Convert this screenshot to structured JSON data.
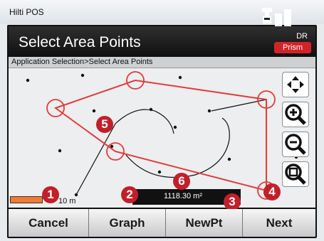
{
  "window": {
    "title": "Hilti POS"
  },
  "header": {
    "title": "Select Area Points",
    "status": {
      "line1": "DR",
      "mode": "Prism"
    }
  },
  "breadcrumb": "Application Selection>Select Area Points",
  "map": {
    "scale_label": "10 m",
    "area_readout": "1118.30  m²",
    "markers": [
      "1",
      "2",
      "3",
      "4",
      "5",
      "6"
    ]
  },
  "softkeys": [
    "Cancel",
    "Graph",
    "NewPt",
    "Next"
  ],
  "colors": {
    "accent": "#c0202a",
    "prism": "#d2232a",
    "scale_bar": "#f47a32"
  }
}
